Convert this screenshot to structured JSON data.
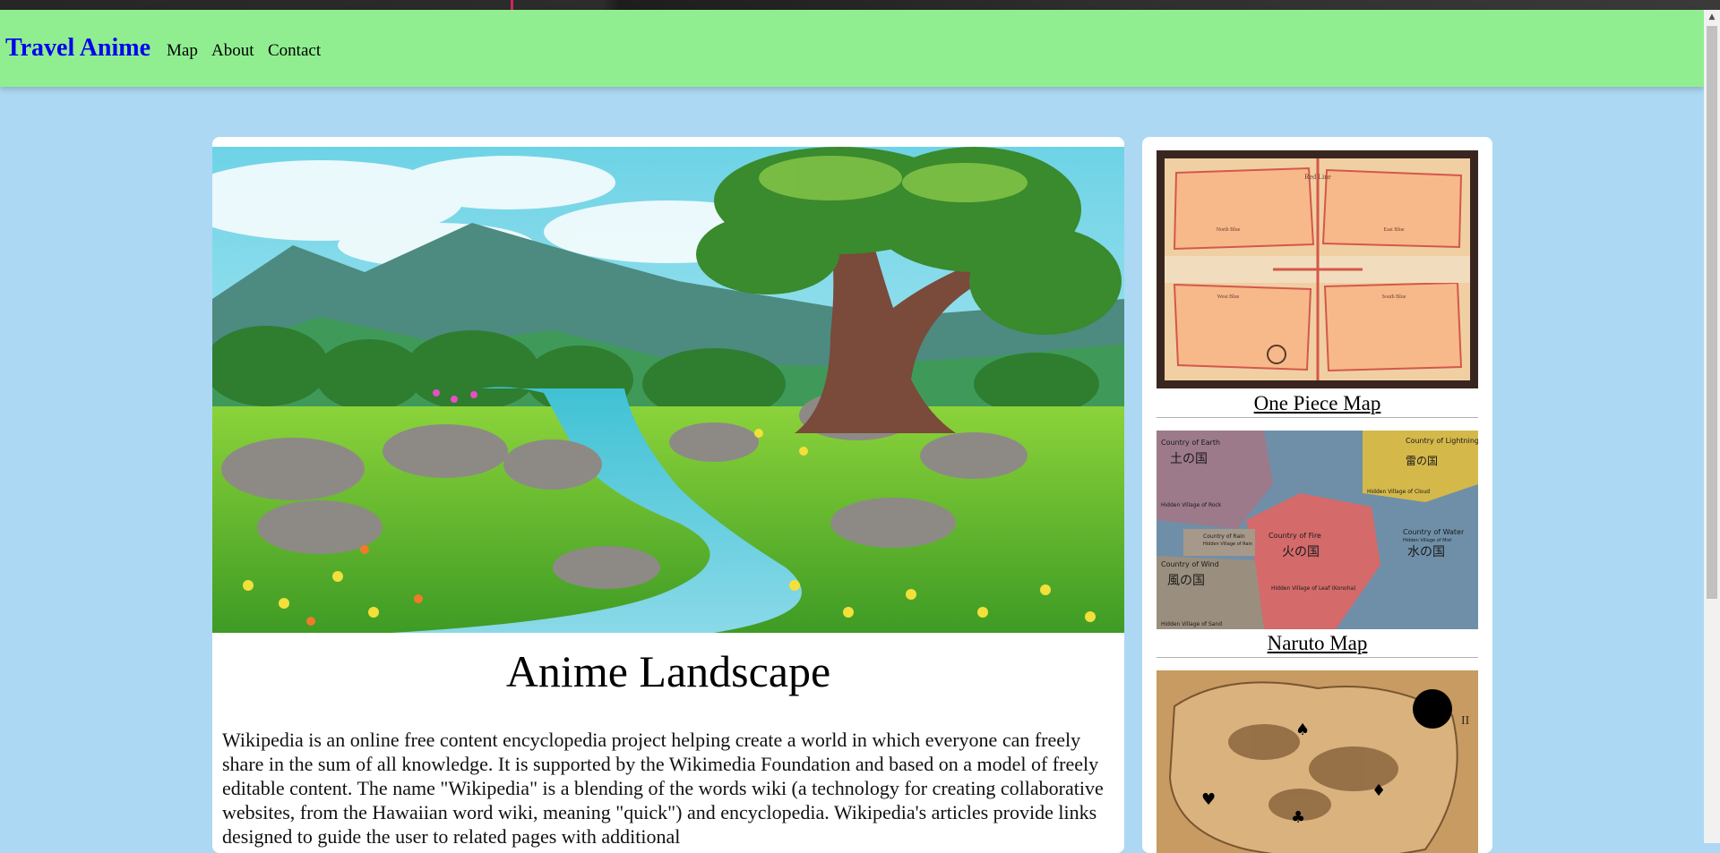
{
  "nav": {
    "brand": "Travel Anime",
    "links": [
      "Map",
      "About",
      "Contact"
    ]
  },
  "main": {
    "image_alt": "anime landscape painting with tree, mountains and stream",
    "title": "Anime Landscape",
    "paragraph": "Wikipedia is an online free content encyclopedia project helping create a world in which everyone can freely share in the sum of all knowledge. It is supported by the Wikimedia Foundation and based on a model of freely editable content. The name \"Wikipedia\" is a blending of the words wiki (a technology for creating collaborative websites, from the Hawaiian word wiki, meaning \"quick\") and encyclopedia. Wikipedia's articles provide links designed to guide the user to related pages with additional"
  },
  "sidebar": {
    "maps": [
      {
        "label": "One Piece Map",
        "image_text": [
          "Red Line",
          "North Blue",
          "East Blue",
          "West Blue",
          "South Blue"
        ]
      },
      {
        "label": "Naruto Map",
        "image_text": [
          "Country of Earth",
          "土の国",
          "Hidden Village of Rock",
          "Country of Lightning",
          "雷の国",
          "Hidden Village of Cloud",
          "Country of Rain",
          "Hidden Village of Rain",
          "Country of Fire",
          "火の国",
          "Hidden Village of Leaf (Konoha)",
          "Country of Water",
          "Hidden Village of Mist",
          "水の国",
          "Country of Wind",
          "風の国",
          "Hidden Village of Sand"
        ]
      },
      {
        "label": "",
        "image_text": [
          "II"
        ]
      }
    ]
  },
  "colors": {
    "navbar": "#90ee90",
    "background": "#acd8f3",
    "brand": "#0000ee"
  }
}
